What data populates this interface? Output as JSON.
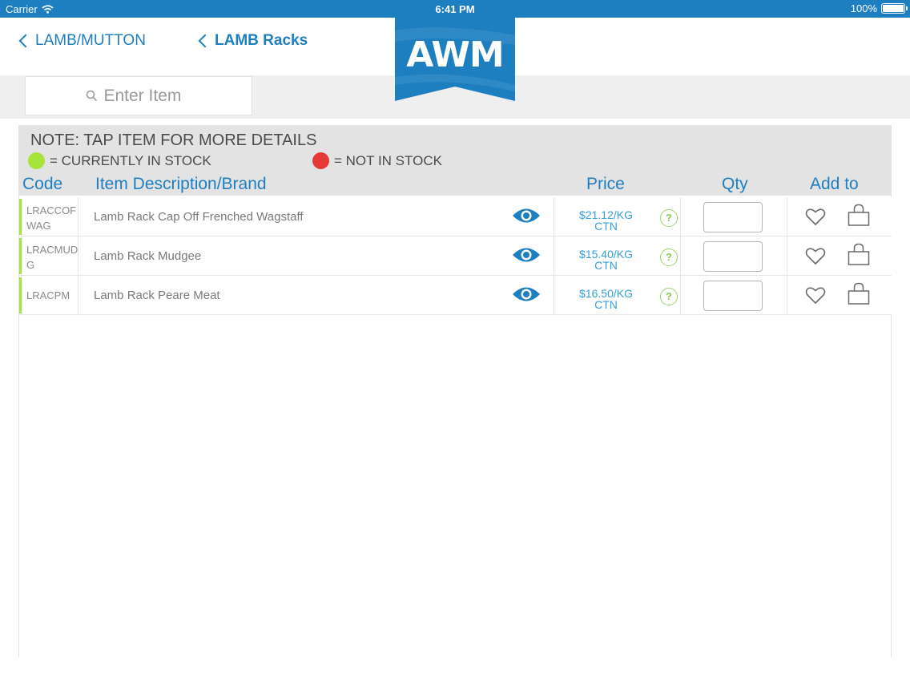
{
  "status_bar": {
    "carrier": "Carrier",
    "time": "6:41 PM",
    "battery": "100%"
  },
  "nav": {
    "back_primary": "LAMB/MUTTON",
    "back_secondary": "LAMB Racks"
  },
  "logo": {
    "text": "AWM"
  },
  "search": {
    "placeholder": "Enter Item"
  },
  "note": {
    "title": "NOTE: TAP ITEM FOR MORE DETAILS",
    "in_stock": "= CURRENTLY IN STOCK",
    "not_in_stock": "= NOT IN STOCK"
  },
  "columns": {
    "code": "Code",
    "description": "Item Description/Brand",
    "price": "Price",
    "qty": "Qty",
    "add_to": "Add to"
  },
  "items": [
    {
      "code": "LRACCOFWAG",
      "description": "Lamb Rack Cap Off Frenched Wagstaff",
      "price": "$21.12/KG",
      "unit": "CTN",
      "qty": ""
    },
    {
      "code": "LRACMUDG",
      "description": "Lamb Rack Mudgee",
      "price": "$15.40/KG",
      "unit": "CTN",
      "qty": ""
    },
    {
      "code": "LRACPM",
      "description": "Lamb Rack Peare Meat",
      "price": "$16.50/KG",
      "unit": "CTN",
      "qty": ""
    }
  ],
  "help_glyph": "?",
  "icons": {
    "search": "search-icon",
    "back": "chevron-left-icon",
    "view": "eye-icon",
    "help": "question-icon",
    "favorite": "heart-icon",
    "cart": "bag-icon",
    "wifi": "wifi-icon",
    "battery": "battery-icon"
  },
  "colors": {
    "brand_blue": "#1e7fc0",
    "price_blue": "#36a0d8",
    "in_stock": "#a6e33b",
    "not_in_stock": "#e53935",
    "help_green": "#8cc85a"
  }
}
